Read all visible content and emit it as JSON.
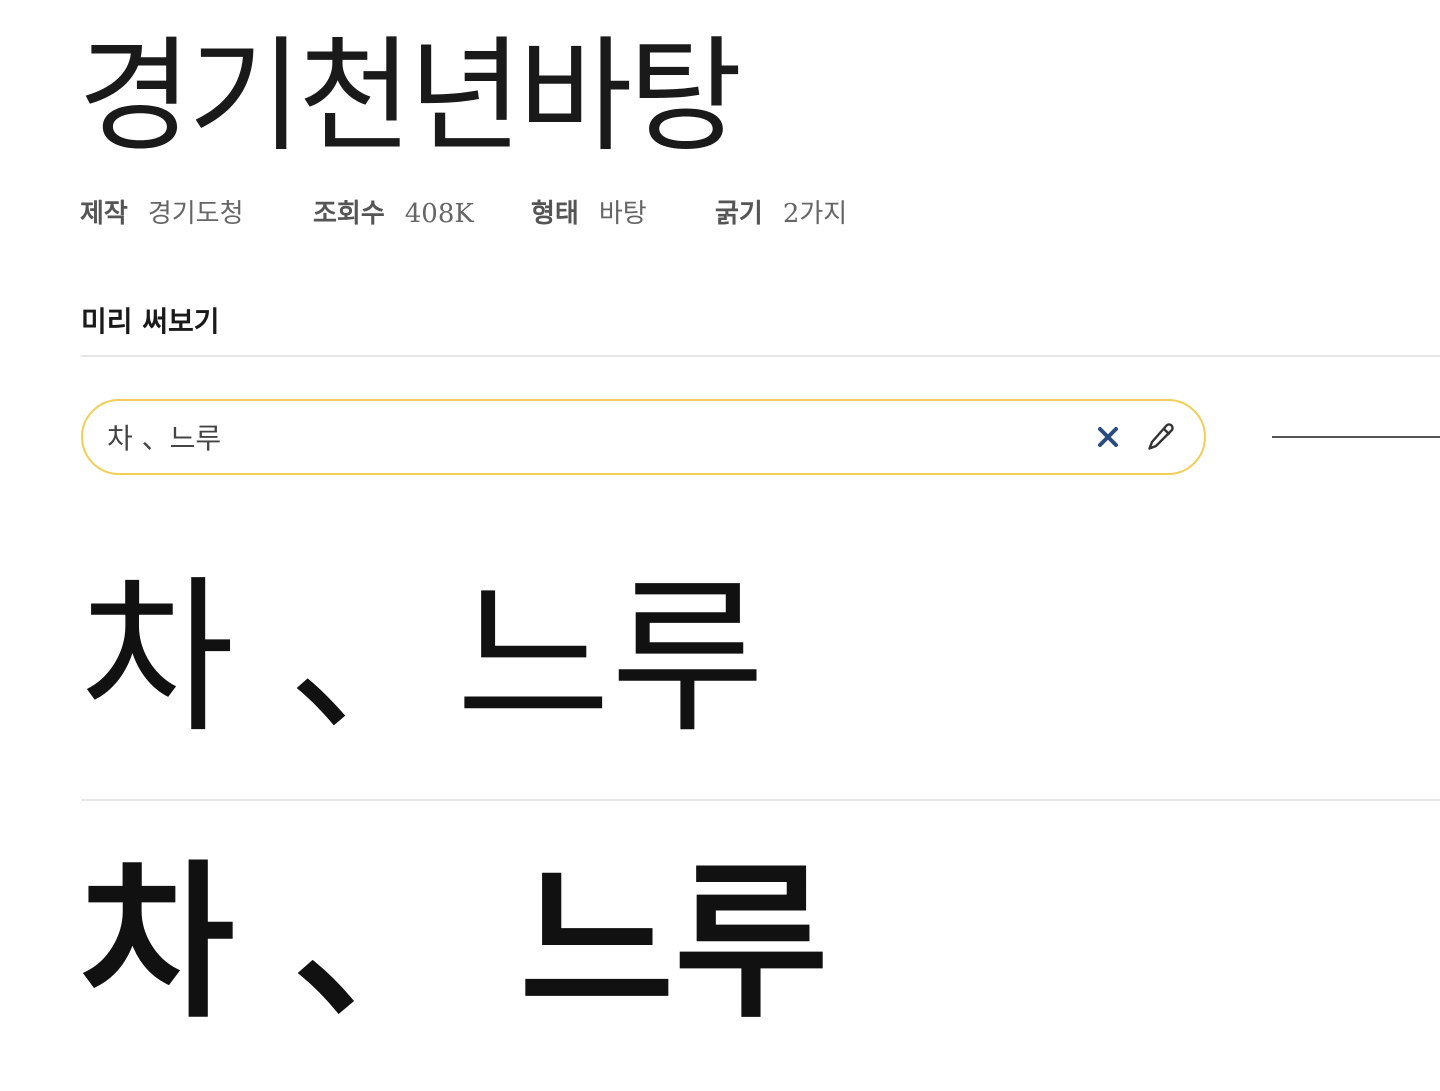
{
  "font": {
    "name": "경기천년바탕"
  },
  "meta": {
    "maker_label": "제작",
    "maker_value": "경기도청",
    "views_label": "조회수",
    "views_value": "408K",
    "type_label": "형태",
    "type_value": "바탕",
    "weight_label": "굵기",
    "weight_value": "2가지"
  },
  "preview": {
    "section_title": "미리 써보기",
    "input_value": "차 、느루",
    "clear_icon": "close-icon",
    "edit_icon": "pencil-icon",
    "samples": {
      "regular": "차 、느루",
      "bold": "차 、 느루"
    }
  },
  "colors": {
    "input_border": "#f1cf56",
    "clear_icon": "#2b4c7e",
    "divider": "#e6e6e6"
  }
}
